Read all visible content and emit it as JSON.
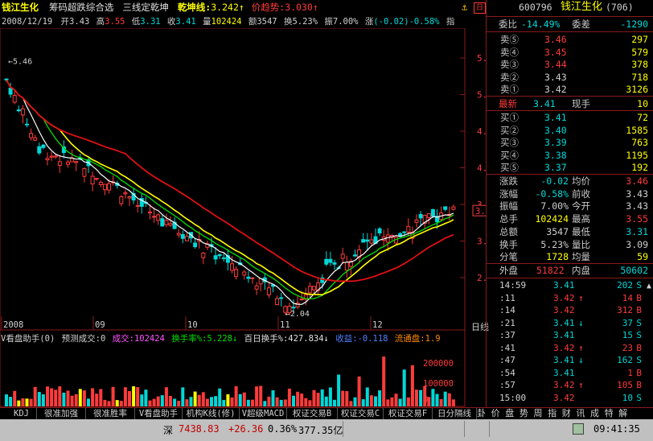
{
  "header": {
    "stock_name": "钱江生化",
    "indicator_name": "筹码超跌综合选",
    "indicator_desc": "三线定乾坤",
    "qiankun_label": "乾坤线:",
    "qiankun_value": "3.242",
    "trend_label": "价趋势:",
    "trend_value": "3.030"
  },
  "ohlc_bar": {
    "date": "2008/12/19",
    "open_label": "开",
    "open": "3.43",
    "high_label": "高",
    "high": "3.55",
    "low_label": "低",
    "low": "3.31",
    "close_label": "收",
    "close": "3.41",
    "vol_label": "量",
    "vol": "102424",
    "amt_label": "额",
    "amt": "3547",
    "turn_label": "换",
    "turn": "5.23%",
    "amp_label": "振",
    "amp": "7.00%",
    "chg_label": "涨",
    "chg": "(-0.02)-0.58%",
    "tail": "指"
  },
  "price_axis": [
    "5.50",
    "5.00",
    "4.50",
    "4.00",
    "3.50",
    "3.00",
    "2.50"
  ],
  "price_tag": "3.41",
  "max_price_label": "5.46",
  "min_price_label": "2.04",
  "date_labels": [
    "2008",
    "09",
    "10",
    "11",
    "12"
  ],
  "period_label": "日线",
  "sub_indicator": {
    "name": "V看盘助手(0)",
    "predict_label": "预测成交:0",
    "vol_label": "成交:",
    "vol": "102424",
    "turn_label": "换手率%:",
    "turn": "5.228",
    "bai_label": "百日换手%:",
    "bai": "427.834",
    "shou_label": "收益:",
    "shou": "-0.118",
    "flow_label": "流通盘:",
    "flow": "1.9"
  },
  "vol_axis": [
    "200000",
    "100000",
    "0"
  ],
  "tabs": [
    "KDJ",
    "很准加强",
    "很准胜率",
    "V看盘助手",
    "机构K线(修)",
    "V超级MACD",
    "权证交易B",
    "权证交易C",
    "权证交易F",
    "日分隔线"
  ],
  "right_tools": "卦 价 盘 势 周 指 财 讯 成 特 解",
  "panel": {
    "code": "600796",
    "name": "钱江生化",
    "count": "(706)",
    "weibi_label": "委比",
    "weibi": "-14.49%",
    "weicha_label": "委差",
    "weicha": "-1290",
    "sells": [
      {
        "label": "卖⑤",
        "price": "3.46",
        "vol": "297"
      },
      {
        "label": "卖④",
        "price": "3.45",
        "vol": "579"
      },
      {
        "label": "卖③",
        "price": "3.44",
        "vol": "378"
      },
      {
        "label": "卖②",
        "price": "3.43",
        "vol": "718"
      },
      {
        "label": "卖①",
        "price": "3.42",
        "vol": "3126"
      }
    ],
    "latest_label": "最新",
    "latest": "3.41",
    "xianshou_label": "现手",
    "xianshou": "10",
    "buys": [
      {
        "label": "买①",
        "price": "3.41",
        "vol": "72"
      },
      {
        "label": "买②",
        "price": "3.40",
        "vol": "1585"
      },
      {
        "label": "买③",
        "price": "3.39",
        "vol": "763"
      },
      {
        "label": "买④",
        "price": "3.38",
        "vol": "1195"
      },
      {
        "label": "买⑤",
        "price": "3.37",
        "vol": "192"
      }
    ],
    "stats": [
      {
        "l1": "涨跌",
        "v1": "-0.02",
        "l2": "均价",
        "v2": "3.46"
      },
      {
        "l1": "涨幅",
        "v1": "-0.58%",
        "l2": "前收",
        "v2": "3.43"
      },
      {
        "l1": "振幅",
        "v1": "7.00%",
        "l2": "今开",
        "v2": "3.43"
      },
      {
        "l1": "总手",
        "v1": "102424",
        "l2": "最高",
        "v2": "3.55"
      },
      {
        "l1": "总额",
        "v1": "3547",
        "l2": "最低",
        "v2": "3.31"
      },
      {
        "l1": "换手",
        "v1": "5.23%",
        "l2": "量比",
        "v2": "3.09"
      },
      {
        "l1": "分笔",
        "v1": "1728",
        "l2": "均量",
        "v2": "59"
      }
    ],
    "waipan_label": "外盘",
    "waipan": "51822",
    "neipan_label": "内盘",
    "neipan": "50602",
    "ticks": [
      {
        "time": "14:59",
        "price": "3.41",
        "arrow": "",
        "vol": "202",
        "side": "S"
      },
      {
        "time": ":11",
        "price": "3.42",
        "arrow": "↑",
        "vol": "14",
        "side": "B"
      },
      {
        "time": ":14",
        "price": "3.42",
        "arrow": "",
        "vol": "312",
        "side": "B"
      },
      {
        "time": ":21",
        "price": "3.41",
        "arrow": "↓",
        "vol": "37",
        "side": "S"
      },
      {
        "time": ":37",
        "price": "3.41",
        "arrow": "",
        "vol": "15",
        "side": "S"
      },
      {
        "time": ":41",
        "price": "3.42",
        "arrow": "↑",
        "vol": "23",
        "side": "B"
      },
      {
        "time": ":47",
        "price": "3.41",
        "arrow": "↓",
        "vol": "162",
        "side": "S"
      },
      {
        "time": ":54",
        "price": "3.41",
        "arrow": "",
        "vol": "1",
        "side": "B"
      },
      {
        "time": ":57",
        "price": "3.42",
        "arrow": "↑",
        "vol": "105",
        "side": "B"
      },
      {
        "time": "15:00",
        "price": "3.42",
        "arrow": "",
        "vol": "10",
        "side": "S"
      }
    ]
  },
  "status": {
    "market": "深",
    "index": "7438.83",
    "change": "+26.36",
    "pct": "0.36%",
    "amount": "377.35亿",
    "time": "09:41:35"
  },
  "colors": {
    "up": "#ff3b3b",
    "down": "#00d8d8",
    "ma_white": "#ffffff",
    "ma_yellow": "#ffff00",
    "ma_green": "#00e000",
    "ma_red": "#e01010"
  }
}
